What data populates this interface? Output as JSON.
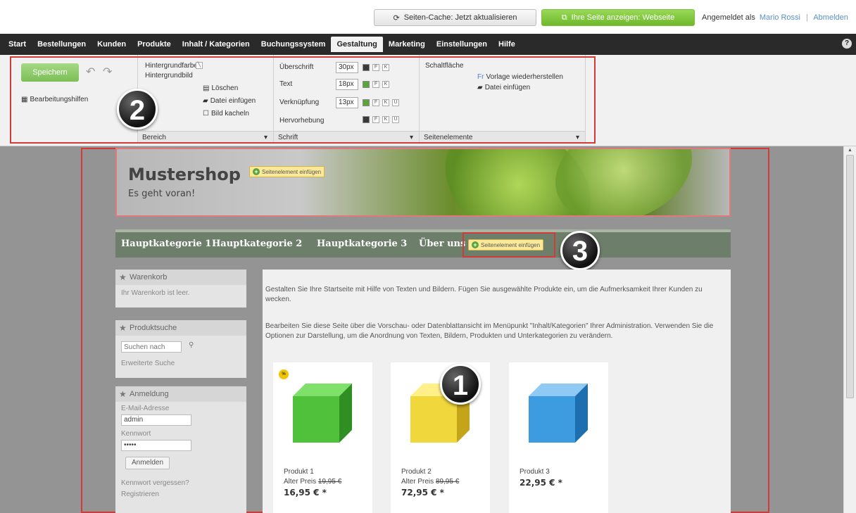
{
  "topbar": {
    "cache_button": "Seiten-Cache: Jetzt aktualisieren",
    "view_button": "Ihre Seite anzeigen: Webseite",
    "logged_in_as": "Angemeldet als",
    "user": "Mario Rossi",
    "logout": "Abmelden"
  },
  "menu": {
    "items": [
      "Start",
      "Bestellungen",
      "Kunden",
      "Produkte",
      "Inhalt / Kategorien",
      "Buchungssystem",
      "Gestaltung",
      "Marketing",
      "Einstellungen",
      "Hilfe"
    ],
    "active": "Gestaltung",
    "help": "?"
  },
  "ribbon": {
    "save": "Speichern",
    "edit_help": "Bearbeitungshilfen",
    "bg_color": "Hintergrundfarbe",
    "bg_image": "Hintergrundbild",
    "delete": "Löschen",
    "insert_file": "Datei einfügen",
    "tile_image": "Bild kacheln",
    "area_group": "Bereich",
    "heading": "Überschrift",
    "heading_size": "30px",
    "text": "Text",
    "text_size": "18px",
    "link": "Verknüpfung",
    "link_size": "13px",
    "highlight": "Hervorhebung",
    "font_group": "Schrift",
    "button_label": "Schaltfläche",
    "restore_template": "Vorlage wiederherstellen",
    "insert_file2": "Datei einfügen",
    "elements_group": "Seitenelemente",
    "badges": [
      "1",
      "2",
      "3"
    ]
  },
  "shop": {
    "title": "Mustershop",
    "subtitle": "Es geht voran!",
    "insert_element": "Seitenelement einfügen",
    "nav": [
      "Hauptkategorie 1",
      "Hauptkategorie 2",
      "Hauptkategorie 3",
      "Über uns"
    ],
    "cart_title": "Warenkorb",
    "cart_empty": "Ihr Warenkorb ist leer.",
    "search_title": "Produktsuche",
    "search_placeholder": "Suchen nach",
    "advanced_search": "Erweiterte Suche",
    "login_title": "Anmeldung",
    "email_label": "E-Mail-Adresse",
    "email_value": "admin",
    "password_label": "Kennwort",
    "password_value": "•••••",
    "login_button": "Anmelden",
    "forgot_password": "Kennwort vergessen?",
    "register": "Registrieren",
    "intro1": "Gestalten Sie Ihre Startseite mit Hilfe von Texten und Bildern. Fügen Sie ausgewählte Produkte ein, um die Aufmerksamkeit Ihrer Kunden zu wecken.",
    "intro2": "Bearbeiten Sie diese Seite über die Vorschau- oder Datenblattansicht im Menüpunkt \"Inhalt/Kategorien\" Ihrer Administration. Verwenden Sie die Optionen zur Darstellung, um die Anordnung von Texten, Bildern, Produkten und Unterkategorien zu verändern.",
    "products": [
      {
        "name": "Produkt 1",
        "old_label": "Alter Preis",
        "old_price": "19,95 €",
        "price": "16,95 € *",
        "color": "#4fc13a",
        "sale": "%"
      },
      {
        "name": "Produkt 2",
        "old_label": "Alter Preis",
        "old_price": "89,95 €",
        "price": "72,95 € *",
        "color": "#f0d73c",
        "sale": ""
      },
      {
        "name": "Produkt 3",
        "old_label": "",
        "old_price": "",
        "price": "22,95 € *",
        "color": "#3d9be0",
        "sale": ""
      }
    ]
  },
  "colors": {
    "accent_green": "#7cbf55",
    "highlight_red": "#d23a3a",
    "nav_bg": "#6d7f6a"
  }
}
